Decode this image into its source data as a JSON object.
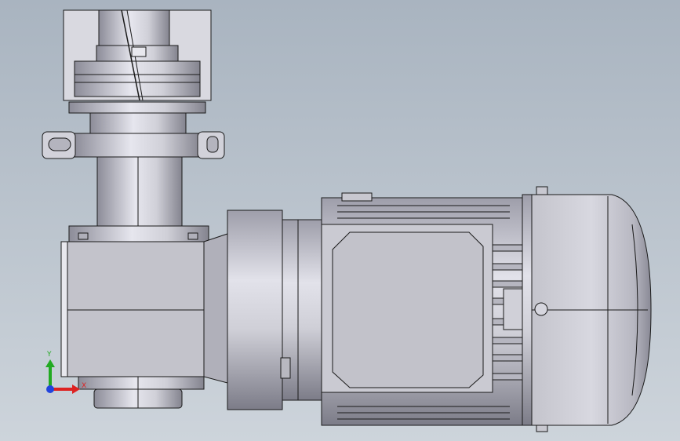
{
  "viewport": {
    "background_top": "#a9b4c0",
    "background_bottom": "#cdd4db"
  },
  "model": {
    "part_color": "#c9c9d1",
    "edge_color": "#1a1a1a"
  },
  "triad": {
    "y_label": "Y",
    "x_label": "X",
    "y_color": "#22aa22",
    "x_color": "#dd2222",
    "z_color": "#2244dd"
  }
}
